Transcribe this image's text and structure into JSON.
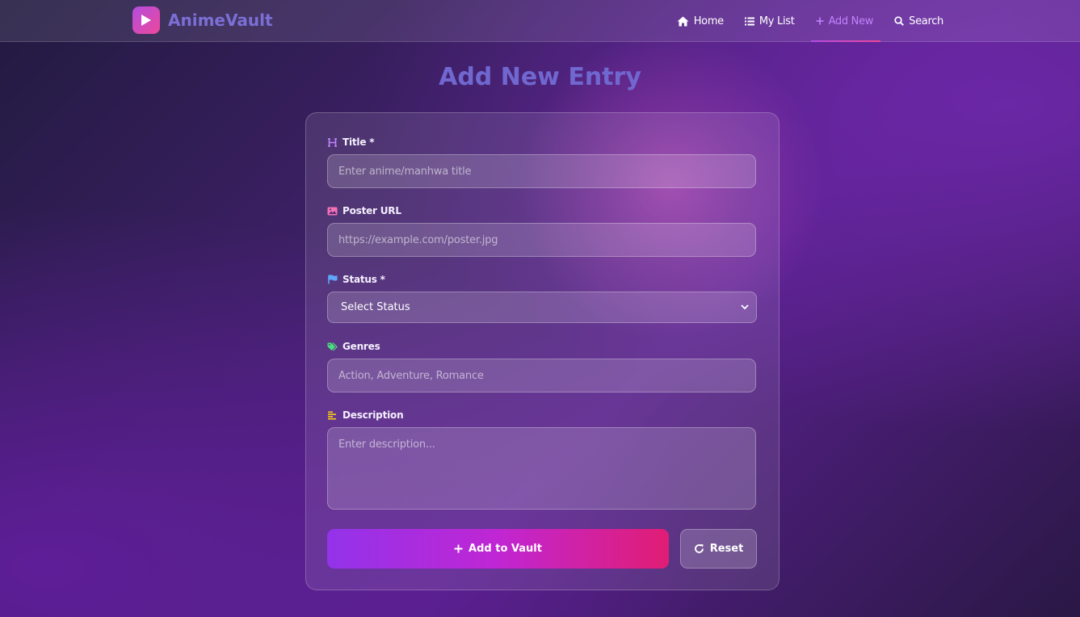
{
  "brand": {
    "name": "AnimeVault",
    "icon": "play-icon"
  },
  "nav": {
    "items": [
      {
        "label": "Home",
        "icon": "home-icon",
        "active": false
      },
      {
        "label": "My List",
        "icon": "list-icon",
        "active": false
      },
      {
        "label": "Add New",
        "icon": "plus-icon",
        "active": true
      },
      {
        "label": "Search",
        "icon": "search-icon",
        "active": false
      }
    ]
  },
  "page": {
    "title": "Add New Entry"
  },
  "form": {
    "title": {
      "label": "Title *",
      "placeholder": "Enter anime/manhwa title",
      "icon": "heading-icon",
      "icon_color": "#c084fc"
    },
    "poster": {
      "label": "Poster URL",
      "placeholder": "https://example.com/poster.jpg",
      "icon": "image-icon",
      "icon_color": "#f472b6"
    },
    "status": {
      "label": "Status *",
      "selected": "Select Status",
      "icon": "flag-icon",
      "icon_color": "#60a5fa"
    },
    "genres": {
      "label": "Genres",
      "placeholder": "Action, Adventure, Romance",
      "icon": "tag-icon",
      "icon_color": "#4ade80"
    },
    "description": {
      "label": "Description",
      "placeholder": "Enter description...",
      "icon": "align-left-icon",
      "icon_color": "#facc15"
    },
    "submit_label": "Add to Vault",
    "reset_label": "Reset"
  },
  "colors": {
    "accent": "#c084fc",
    "brand_text": "#7b6fd6",
    "primary_gradient_start": "#9333ea",
    "primary_gradient_end": "#e11d74"
  }
}
